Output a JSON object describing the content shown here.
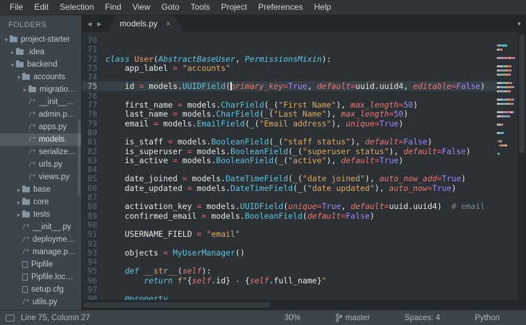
{
  "menu": {
    "items": [
      "File",
      "Edit",
      "Selection",
      "Find",
      "View",
      "Goto",
      "Tools",
      "Project",
      "Preferences",
      "Help"
    ]
  },
  "tabbar": {
    "nav_back": "◀",
    "nav_forward": "▶",
    "overflow": "▼",
    "tabs": [
      {
        "label": "models.py",
        "close": "×",
        "active": true
      }
    ]
  },
  "sidebar": {
    "header": "FOLDERS",
    "items": [
      {
        "label": "project-starter",
        "type": "folder",
        "indent": 0,
        "expanded": true
      },
      {
        "label": ".idea",
        "type": "folder",
        "indent": 1,
        "expanded": false
      },
      {
        "label": "backend",
        "type": "folder",
        "indent": 1,
        "expanded": true
      },
      {
        "label": "accounts",
        "type": "folder",
        "indent": 2,
        "expanded": true
      },
      {
        "label": "migratio…",
        "type": "folder",
        "indent": 3,
        "expanded": false
      },
      {
        "label": "__init__…",
        "type": "file-python",
        "indent": 3
      },
      {
        "label": "admin.p…",
        "type": "file-python",
        "indent": 3
      },
      {
        "label": "apps.py",
        "type": "file-python",
        "indent": 3
      },
      {
        "label": "models.",
        "type": "file-python",
        "indent": 3,
        "selected": true
      },
      {
        "label": "serialize…",
        "type": "file-python",
        "indent": 3
      },
      {
        "label": "urls.py",
        "type": "file-python",
        "indent": 3
      },
      {
        "label": "views.py",
        "type": "file-python",
        "indent": 3
      },
      {
        "label": "base",
        "type": "folder",
        "indent": 2,
        "expanded": false
      },
      {
        "label": "core",
        "type": "folder",
        "indent": 2,
        "expanded": false
      },
      {
        "label": "tests",
        "type": "folder",
        "indent": 2,
        "expanded": false
      },
      {
        "label": "__init__.py",
        "type": "file-python",
        "indent": 2
      },
      {
        "label": "deployme…",
        "type": "file-python",
        "indent": 2
      },
      {
        "label": "manage.p…",
        "type": "file-python",
        "indent": 2
      },
      {
        "label": "Pipfile",
        "type": "file-plain",
        "indent": 2
      },
      {
        "label": "Pipfile.loc…",
        "type": "file-plain",
        "indent": 2
      },
      {
        "label": "setup.cfg",
        "type": "file-plain",
        "indent": 2
      },
      {
        "label": "utils.py",
        "type": "file-python",
        "indent": 2
      }
    ]
  },
  "icons": {
    "python_file": "/*"
  },
  "editor": {
    "cursor": {
      "line": 75,
      "column": 27
    },
    "lines": [
      {
        "num": 70,
        "tokens": []
      },
      {
        "num": 71,
        "tokens": []
      },
      {
        "num": 72,
        "tokens": [
          [
            "kw",
            "class"
          ],
          [
            "pl",
            " "
          ],
          [
            "cls",
            "User"
          ],
          [
            "pl",
            "("
          ],
          [
            "sup",
            "AbstractBaseUser"
          ],
          [
            "pl",
            ", "
          ],
          [
            "sup",
            "PermissionsMixin"
          ],
          [
            "pl",
            "):"
          ]
        ]
      },
      {
        "num": 73,
        "tokens": [
          [
            "pl",
            "    app_label "
          ],
          [
            "op",
            "="
          ],
          [
            "pl",
            " "
          ],
          [
            "str",
            "\"accounts\""
          ]
        ]
      },
      {
        "num": 74,
        "tokens": []
      },
      {
        "num": 75,
        "tokens": [
          [
            "pl",
            "    id "
          ],
          [
            "op",
            "="
          ],
          [
            "pl",
            " models."
          ],
          [
            "fn",
            "UUIDField"
          ],
          [
            "pl",
            "("
          ],
          [
            "par",
            "primary_key"
          ],
          [
            "op",
            "="
          ],
          [
            "num",
            "True"
          ],
          [
            "pl",
            ", "
          ],
          [
            "par",
            "default"
          ],
          [
            "op",
            "="
          ],
          [
            "pl",
            "uuid.uuid4, "
          ],
          [
            "par",
            "editable"
          ],
          [
            "op",
            "="
          ],
          [
            "num",
            "False"
          ],
          [
            "pl",
            ")"
          ]
        ]
      },
      {
        "num": 76,
        "tokens": []
      },
      {
        "num": 77,
        "tokens": [
          [
            "pl",
            "    first_name "
          ],
          [
            "op",
            "="
          ],
          [
            "pl",
            " models."
          ],
          [
            "fn",
            "CharField"
          ],
          [
            "pl",
            "(_("
          ],
          [
            "str",
            "\"First Name\""
          ],
          [
            "pl",
            "), "
          ],
          [
            "par",
            "max_length"
          ],
          [
            "op",
            "="
          ],
          [
            "num",
            "50"
          ],
          [
            "pl",
            ")"
          ]
        ]
      },
      {
        "num": 78,
        "tokens": [
          [
            "pl",
            "    last_name "
          ],
          [
            "op",
            "="
          ],
          [
            "pl",
            " models."
          ],
          [
            "fn",
            "CharField"
          ],
          [
            "pl",
            "(_("
          ],
          [
            "str",
            "\"Last Name\""
          ],
          [
            "pl",
            "), "
          ],
          [
            "par",
            "max_length"
          ],
          [
            "op",
            "="
          ],
          [
            "num",
            "50"
          ],
          [
            "pl",
            ")"
          ]
        ]
      },
      {
        "num": 79,
        "tokens": [
          [
            "pl",
            "    email "
          ],
          [
            "op",
            "="
          ],
          [
            "pl",
            " models."
          ],
          [
            "fn",
            "EmailField"
          ],
          [
            "pl",
            "(_("
          ],
          [
            "str",
            "\"Email address\""
          ],
          [
            "pl",
            "), "
          ],
          [
            "par",
            "unique"
          ],
          [
            "op",
            "="
          ],
          [
            "num",
            "True"
          ],
          [
            "pl",
            ")"
          ]
        ]
      },
      {
        "num": 80,
        "tokens": []
      },
      {
        "num": 81,
        "tokens": [
          [
            "pl",
            "    is_staff "
          ],
          [
            "op",
            "="
          ],
          [
            "pl",
            " models."
          ],
          [
            "fn",
            "BooleanField"
          ],
          [
            "pl",
            "(_("
          ],
          [
            "str",
            "\"staff status\""
          ],
          [
            "pl",
            "), "
          ],
          [
            "par",
            "default"
          ],
          [
            "op",
            "="
          ],
          [
            "num",
            "False"
          ],
          [
            "pl",
            ")"
          ]
        ]
      },
      {
        "num": 82,
        "tokens": [
          [
            "pl",
            "    is_superuser "
          ],
          [
            "op",
            "="
          ],
          [
            "pl",
            " models."
          ],
          [
            "fn",
            "BooleanField"
          ],
          [
            "pl",
            "(_("
          ],
          [
            "str",
            "\"superuser status\""
          ],
          [
            "pl",
            "), "
          ],
          [
            "par",
            "default"
          ],
          [
            "op",
            "="
          ],
          [
            "num",
            "False"
          ],
          [
            "pl",
            ")"
          ]
        ]
      },
      {
        "num": 83,
        "tokens": [
          [
            "pl",
            "    is_active "
          ],
          [
            "op",
            "="
          ],
          [
            "pl",
            " models."
          ],
          [
            "fn",
            "BooleanField"
          ],
          [
            "pl",
            "(_("
          ],
          [
            "str",
            "\"active\""
          ],
          [
            "pl",
            "), "
          ],
          [
            "par",
            "default"
          ],
          [
            "op",
            "="
          ],
          [
            "num",
            "True"
          ],
          [
            "pl",
            ")"
          ]
        ]
      },
      {
        "num": 84,
        "tokens": []
      },
      {
        "num": 85,
        "tokens": [
          [
            "pl",
            "    date_joined "
          ],
          [
            "op",
            "="
          ],
          [
            "pl",
            " models."
          ],
          [
            "fn",
            "DateTimeField"
          ],
          [
            "pl",
            "(_("
          ],
          [
            "str",
            "\"date joined\""
          ],
          [
            "pl",
            "), "
          ],
          [
            "par",
            "auto_now_add"
          ],
          [
            "op",
            "="
          ],
          [
            "num",
            "True"
          ],
          [
            "pl",
            ")"
          ]
        ]
      },
      {
        "num": 86,
        "tokens": [
          [
            "pl",
            "    date_updated "
          ],
          [
            "op",
            "="
          ],
          [
            "pl",
            " models."
          ],
          [
            "fn",
            "DateTimeField"
          ],
          [
            "pl",
            "(_("
          ],
          [
            "str",
            "\"date updated\""
          ],
          [
            "pl",
            "), "
          ],
          [
            "par",
            "auto_now"
          ],
          [
            "op",
            "="
          ],
          [
            "num",
            "True"
          ],
          [
            "pl",
            ")"
          ]
        ]
      },
      {
        "num": 87,
        "tokens": []
      },
      {
        "num": 88,
        "tokens": [
          [
            "pl",
            "    activation_key "
          ],
          [
            "op",
            "="
          ],
          [
            "pl",
            " models."
          ],
          [
            "fn",
            "UUIDField"
          ],
          [
            "pl",
            "("
          ],
          [
            "par",
            "unique"
          ],
          [
            "op",
            "="
          ],
          [
            "num",
            "True"
          ],
          [
            "pl",
            ", "
          ],
          [
            "par",
            "default"
          ],
          [
            "op",
            "="
          ],
          [
            "pl",
            "uuid.uuid4)  "
          ],
          [
            "cm",
            "# email"
          ]
        ]
      },
      {
        "num": 89,
        "tokens": [
          [
            "pl",
            "    confirmed_email "
          ],
          [
            "op",
            "="
          ],
          [
            "pl",
            " models."
          ],
          [
            "fn",
            "BooleanField"
          ],
          [
            "pl",
            "("
          ],
          [
            "par",
            "default"
          ],
          [
            "op",
            "="
          ],
          [
            "num",
            "False"
          ],
          [
            "pl",
            ")"
          ]
        ]
      },
      {
        "num": 90,
        "tokens": []
      },
      {
        "num": 91,
        "tokens": [
          [
            "pl",
            "    USERNAME_FIELD "
          ],
          [
            "op",
            "="
          ],
          [
            "pl",
            " "
          ],
          [
            "str",
            "\"email\""
          ]
        ]
      },
      {
        "num": 92,
        "tokens": []
      },
      {
        "num": 93,
        "tokens": [
          [
            "pl",
            "    objects "
          ],
          [
            "op",
            "="
          ],
          [
            "pl",
            " "
          ],
          [
            "fn",
            "MyUserManager"
          ],
          [
            "pl",
            "()"
          ]
        ]
      },
      {
        "num": 94,
        "tokens": []
      },
      {
        "num": 95,
        "tokens": [
          [
            "pl",
            "    "
          ],
          [
            "kw",
            "def"
          ],
          [
            "pl",
            " "
          ],
          [
            "cls",
            "__str__"
          ],
          [
            "pl",
            "("
          ],
          [
            "par",
            "self"
          ],
          [
            "pl",
            "):"
          ]
        ]
      },
      {
        "num": 96,
        "tokens": [
          [
            "pl",
            "        "
          ],
          [
            "kw",
            "return"
          ],
          [
            "pl",
            " "
          ],
          [
            "str",
            "f\""
          ],
          [
            "pl",
            "{"
          ],
          [
            "par",
            "self"
          ],
          [
            "pl",
            ".id}"
          ],
          [
            "str",
            " - "
          ],
          [
            "pl",
            "{"
          ],
          [
            "par",
            "self"
          ],
          [
            "pl",
            ".full_name}"
          ],
          [
            "str",
            "\""
          ]
        ]
      },
      {
        "num": 97,
        "tokens": []
      },
      {
        "num": 98,
        "tokens": [
          [
            "pl",
            "    "
          ],
          [
            "dec",
            "@property"
          ]
        ]
      }
    ]
  },
  "statusbar": {
    "position": "Line 75, Column 27",
    "percent": "30%",
    "branch": "master",
    "indentation": "Spaces: 4",
    "syntax": "Python"
  },
  "colors": {
    "editor_background": "#2c3136",
    "sidebar_background": "#3d454b",
    "tabbar_background": "#24282b",
    "selection": "#525b61",
    "current_line": "#383f45",
    "keyword": "#5fc6de",
    "class_name": "#f2a15f",
    "string": "#e0ab5f",
    "parameter": "#f07870",
    "operator": "#f55d6e",
    "constant": "#9d8af5",
    "comment": "#7a858d"
  }
}
